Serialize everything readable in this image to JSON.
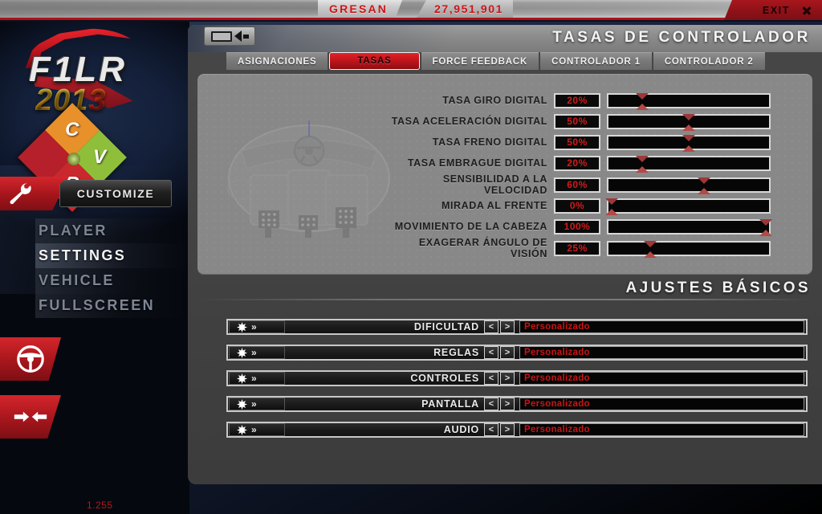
{
  "topbar": {
    "player_name": "GRESAN",
    "money": "27,951,901",
    "exit_label": "EXIT",
    "close_icon": "close-icon"
  },
  "sidebar": {
    "logo_title": "F1LR",
    "logo_year_main": "201",
    "logo_year_accent": "3",
    "cvr_letters": [
      "C",
      "V",
      "R"
    ],
    "customize_label": "CUSTOMIZE",
    "customize_icon": "wrench-icon",
    "menu": [
      {
        "label": "PLAYER",
        "active": false
      },
      {
        "label": "SETTINGS",
        "active": true
      },
      {
        "label": "VEHICLE",
        "active": false
      },
      {
        "label": "FULLSCREEN",
        "active": false
      }
    ],
    "buttons": [
      {
        "icon": "steering-wheel-icon"
      },
      {
        "icon": "arrows-inward-icon"
      }
    ],
    "version": "1.255"
  },
  "panel": {
    "back_icon": "back-arrow-icon",
    "title": "TASAS DE CONTROLADOR",
    "tabs": [
      {
        "label": "ASIGNACIONES",
        "active": false
      },
      {
        "label": "TASAS",
        "active": true
      },
      {
        "label": "FORCE FEEDBACK",
        "active": false
      },
      {
        "label": "CONTROLADOR 1",
        "active": false
      },
      {
        "label": "CONTROLADOR 2",
        "active": false
      }
    ],
    "cockpit_diagram_icon": "cockpit-pedals-diagram"
  },
  "rates": [
    {
      "label": "TASA GIRO DIGITAL",
      "value": "20%",
      "percent": 20
    },
    {
      "label": "TASA ACELERACIÓN DIGITAL",
      "value": "50%",
      "percent": 50
    },
    {
      "label": "TASA FRENO DIGITAL",
      "value": "50%",
      "percent": 50
    },
    {
      "label": "TASA EMBRAGUE DIGITAL",
      "value": "20%",
      "percent": 20
    },
    {
      "label": "SENSIBILIDAD A LA VELOCIDAD",
      "value": "60%",
      "percent": 60
    },
    {
      "label": "MIRADA AL FRENTE",
      "value": "0%",
      "percent": 0
    },
    {
      "label": "MOVIMIENTO DE LA CABEZA",
      "value": "100%",
      "percent": 100
    },
    {
      "label": "EXAGERAR ÁNGULO DE VISIÓN",
      "value": "25%",
      "percent": 25
    }
  ],
  "basic": {
    "title": "AJUSTES BÁSICOS",
    "prev_arrow": "<",
    "next_arrow": ">",
    "rows": [
      {
        "icon": "starburst-icon",
        "label": "DIFICULTAD",
        "value": "Personalizado"
      },
      {
        "icon": "starburst-icon",
        "label": "REGLAS",
        "value": "Personalizado"
      },
      {
        "icon": "starburst-icon",
        "label": "CONTROLES",
        "value": "Personalizado"
      },
      {
        "icon": "starburst-icon",
        "label": "PANTALLA",
        "value": "Personalizado"
      },
      {
        "icon": "starburst-icon",
        "label": "AUDIO",
        "value": "Personalizado"
      }
    ]
  },
  "colors": {
    "accent_red": "#c0161c",
    "value_red": "#c81414",
    "panel_grey": "#414141",
    "rates_grey": "#888888"
  }
}
